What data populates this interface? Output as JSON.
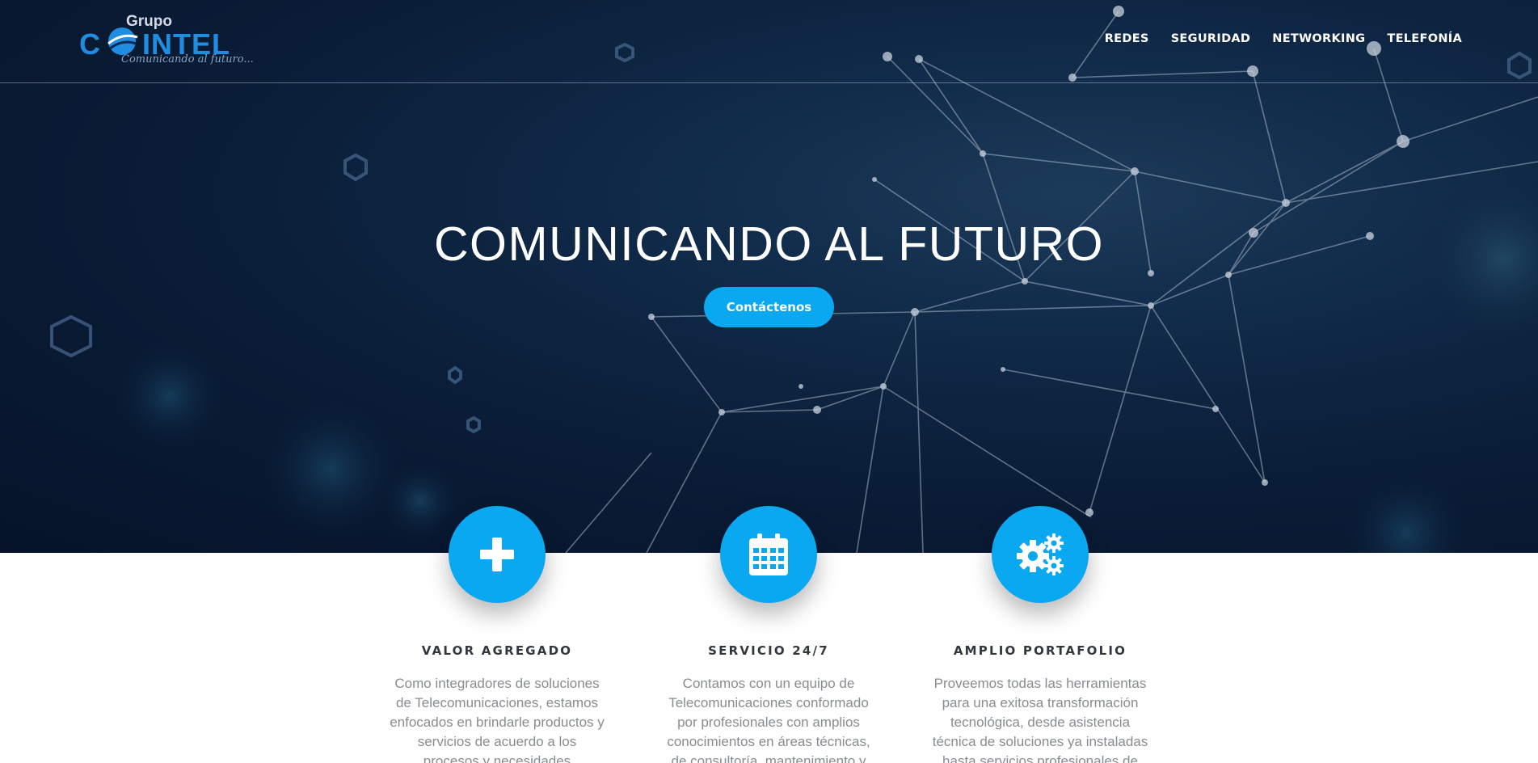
{
  "brand": {
    "logo_top": "Grupo",
    "logo_c": "C",
    "logo_rest": "INTEL",
    "tagline": "Comunicando al futuro...",
    "accent": "#0aa8f0",
    "logo_blue": "#1f8ee0"
  },
  "nav": {
    "items": [
      {
        "label": "REDES"
      },
      {
        "label": "SEGURIDAD"
      },
      {
        "label": "NETWORKING"
      },
      {
        "label": "TELEFONÍA"
      }
    ]
  },
  "hero": {
    "title": "COMUNICANDO AL FUTURO",
    "cta_label": "Contáctenos",
    "background_colors": [
      "#06132a",
      "#0f2947",
      "#1c3a5a"
    ]
  },
  "features": [
    {
      "icon": "plus-icon",
      "title": "VALOR AGREGADO",
      "text": "Como integradores de soluciones de Telecomunicaciones, estamos enfocados en brindarle productos y servicios de acuerdo a los procesos y necesidades particulares de su"
    },
    {
      "icon": "calendar-icon",
      "title": "SERVICIO 24/7",
      "text": "Contamos con un equipo de Telecomunicaciones conformado por profesionales con amplios conocimientos en áreas técnicas, de consultoría, mantenimiento y"
    },
    {
      "icon": "gears-icon",
      "title": "AMPLIO PORTAFOLIO",
      "text": "Proveemos todas las herramientas para una exitosa transformación tecnológica, desde asistencia técnica de soluciones ya instaladas hasta servicios profesionales de asesoría"
    }
  ]
}
